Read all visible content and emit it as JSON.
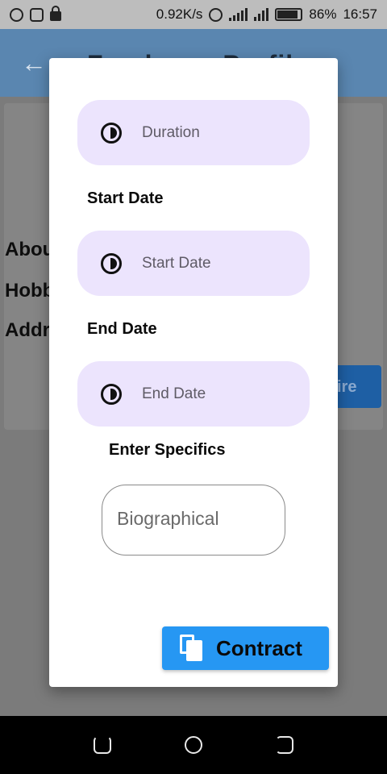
{
  "status_bar": {
    "network_speed": "0.92K/s",
    "battery": "86%",
    "battery_level": 0.86,
    "time": "16:57"
  },
  "app_bar": {
    "title": "Freelance Profile"
  },
  "background": {
    "labels": [
      "About",
      "Hobb",
      "Addr"
    ],
    "hire_button": "ire"
  },
  "dialog": {
    "duration_placeholder": "Duration",
    "start_date_label": "Start Date",
    "start_date_placeholder": "Start Date",
    "end_date_label": "End Date",
    "end_date_placeholder": "End Date",
    "specifics_label": "Enter Specifics",
    "specifics_placeholder": "Biographical",
    "contract_button": "Contract"
  },
  "colors": {
    "pill_background": "#ece4fd",
    "button_accent": "#2697f3",
    "app_bar": "#5a86b0"
  }
}
